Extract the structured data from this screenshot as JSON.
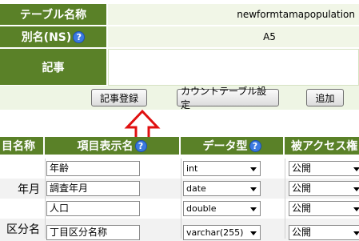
{
  "info": {
    "table_name_label": "テーブル名称",
    "table_name_value": "newformtamapopulation",
    "alias_label": "別名(NS)",
    "alias_value": "A5",
    "description_label": "記事",
    "description_value": ""
  },
  "buttons": {
    "register": "記事登録",
    "count_table": "カウントテーブル設定",
    "add": "追加"
  },
  "columns": {
    "item_name": "目名称",
    "display_name": "項目表示名",
    "data_type": "データ型",
    "access": "被アクセス権"
  },
  "rows": [
    {
      "name": "",
      "display": "年齢",
      "type": "int",
      "access": "公開"
    },
    {
      "name": "年月",
      "display": "調査年月",
      "type": "date",
      "access": "公開"
    },
    {
      "name": "",
      "display": "人口",
      "type": "double",
      "access": "公開"
    },
    {
      "name": "区分名",
      "display": "丁目区分名称",
      "type": "varchar(255)",
      "access": "公開"
    }
  ],
  "icons": {
    "help": "question-help-icon",
    "annotation": "red-up-arrow",
    "dropdown": "chevron-down-icon"
  },
  "colors": {
    "header_green": "#5a8128",
    "light_green": "#f1f6e7",
    "help_blue": "#3c7ae0",
    "arrow_red": "#e01010"
  }
}
